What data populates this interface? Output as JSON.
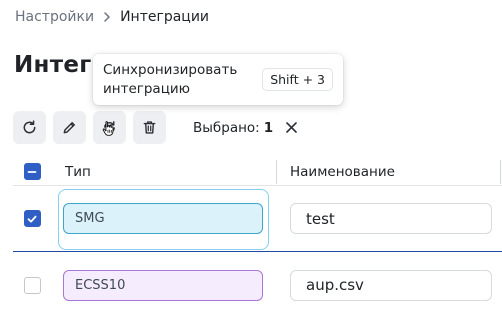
{
  "breadcrumb": {
    "parent": "Настройки",
    "current": "Интеграции"
  },
  "page": {
    "title": "Интегр"
  },
  "tooltip": {
    "text": "Синхронизировать интеграцию",
    "shortcut": "Shift + 3"
  },
  "toolbar": {
    "buttons": [
      {
        "icon": "refresh-icon"
      },
      {
        "icon": "pencil-icon"
      },
      {
        "icon": "sync-icon"
      },
      {
        "icon": "trash-icon"
      }
    ],
    "selected_label": "Выбрано:",
    "selected_count": "1"
  },
  "table": {
    "columns": [
      "Тип",
      "Наименование"
    ],
    "rows": [
      {
        "checked": true,
        "type": "SMG",
        "name": "test"
      },
      {
        "checked": false,
        "type": "ECSS10",
        "name": "aup.csv"
      }
    ]
  },
  "colors": {
    "accent": "#2f5fc4",
    "smg_tag_bg": "#dcf2fb",
    "smg_tag_border": "#3ba7c9",
    "ecss_tag_bg": "#f5ecfd",
    "ecss_tag_border": "#a977d6"
  }
}
